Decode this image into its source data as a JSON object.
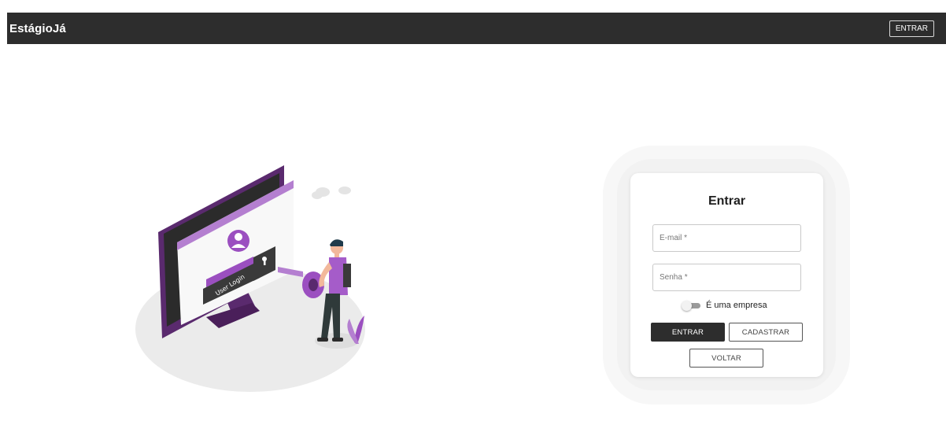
{
  "navbar": {
    "brand": "EstágioJá",
    "enter_label": "ENTRAR"
  },
  "illustration": {
    "screen_label": "User Login",
    "accent_color": "#9b4fc0",
    "dark_accent_color": "#5a2a6e"
  },
  "login": {
    "title": "Entrar",
    "email_placeholder": "E-mail *",
    "password_placeholder": "Senha *",
    "company_toggle_label": "É uma empresa",
    "company_toggle_on": false,
    "enter_label": "ENTRAR",
    "register_label": "CADASTRAR",
    "back_label": "VOLTAR"
  }
}
